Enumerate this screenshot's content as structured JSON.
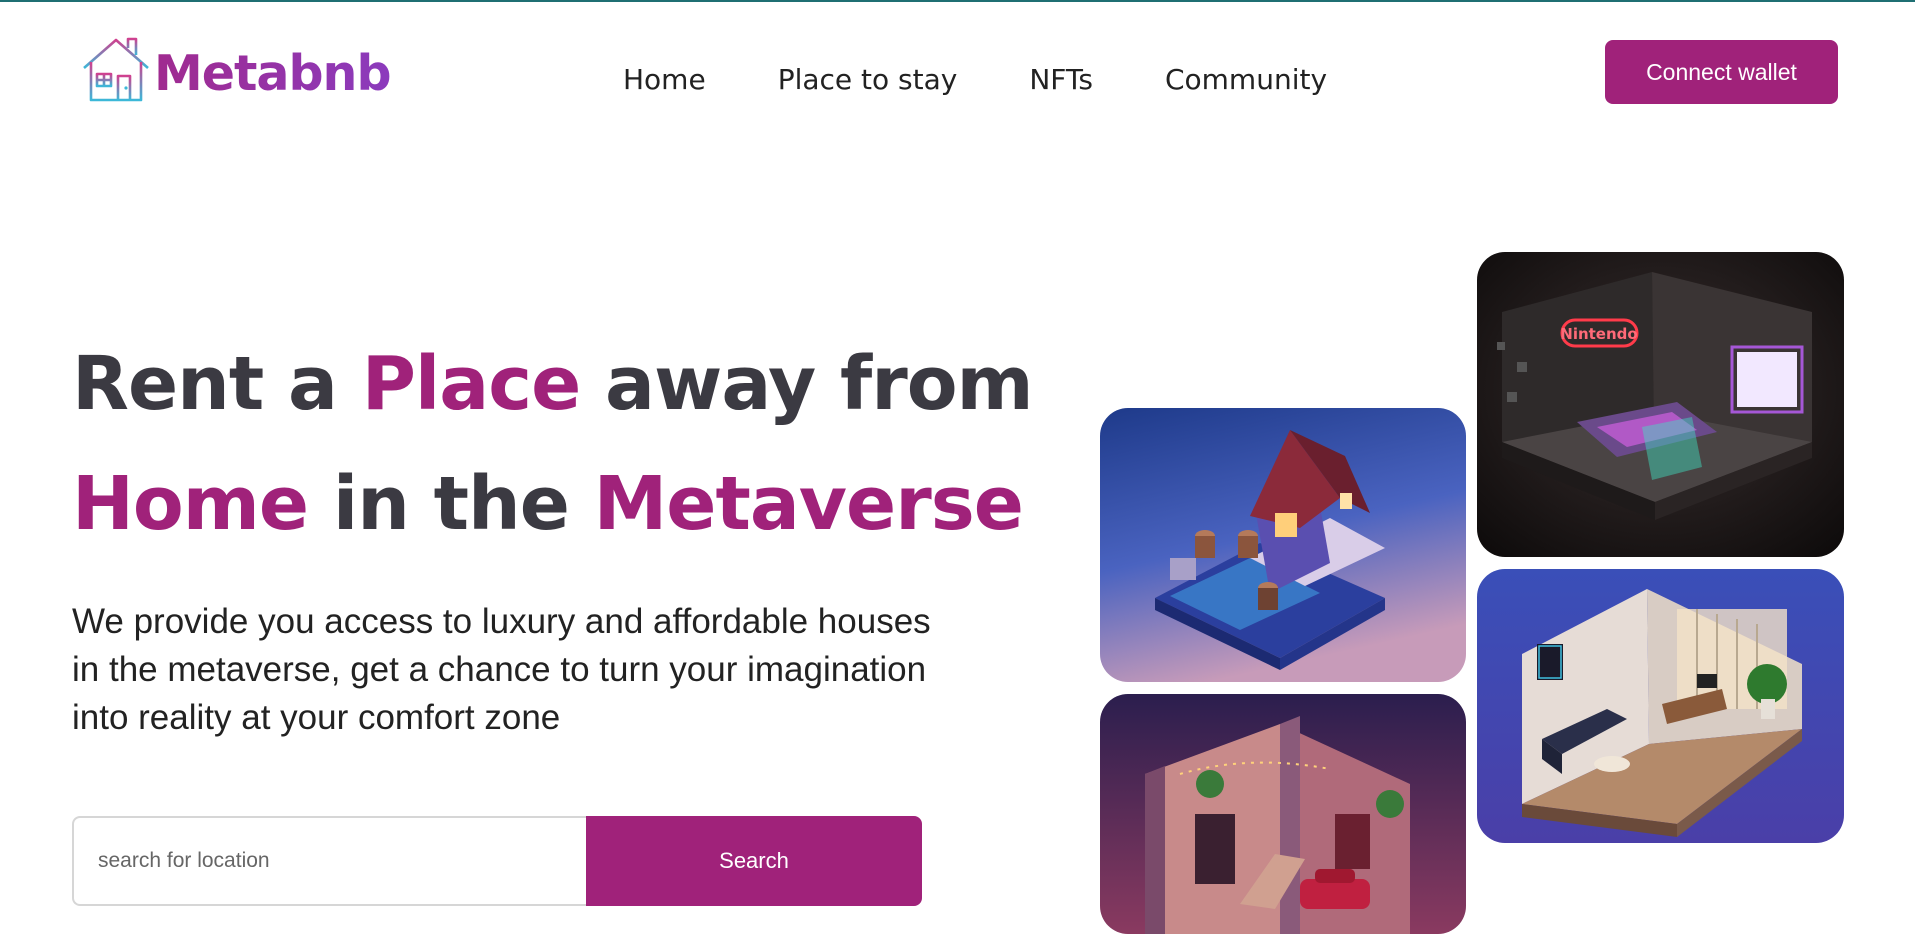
{
  "brand": {
    "name": "Metabnb",
    "logo_icon": "house-icon"
  },
  "nav": {
    "items": [
      {
        "label": "Home"
      },
      {
        "label": "Place to stay"
      },
      {
        "label": "NFTs"
      },
      {
        "label": "Community"
      }
    ]
  },
  "header": {
    "connect_label": "Connect wallet"
  },
  "hero": {
    "headline": {
      "part1": "Rent a ",
      "accent1": "Place",
      "part2": " away from",
      "accent2": "Home",
      "part3": " in the ",
      "accent3": "Metaverse"
    },
    "description": "We provide you access to luxury and affordable houses in the metaverse, get a chance to turn your imagination into reality at your comfort zone"
  },
  "search": {
    "placeholder": "search for location",
    "button_label": "Search"
  },
  "gallery": {
    "nintendo_sign": "Nintendo"
  },
  "colors": {
    "accent": "#a0227a",
    "heading": "#3b3a42",
    "logo_gradient_start": "#a02a8f",
    "logo_gradient_end": "#8b3bbd"
  }
}
